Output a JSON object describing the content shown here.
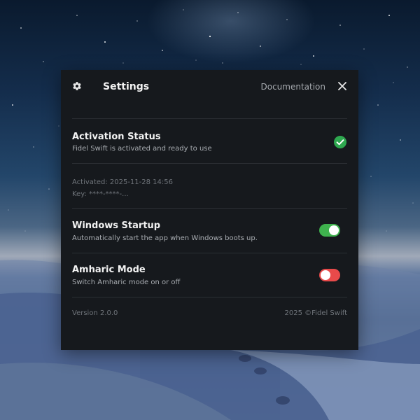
{
  "window": {
    "title": "Settings",
    "documentation_label": "Documentation",
    "icons": {
      "title": "gear-icon",
      "close": "close-icon"
    }
  },
  "activation": {
    "title": "Activation Status",
    "description": "Fidel Swift is activated and ready to use",
    "activated_at": "Activated: 2025-11-28 14:56",
    "key": "Key: ****-****-...",
    "status_icon": "check-circle-icon",
    "status_color": "#2ea84f"
  },
  "startup": {
    "title": "Windows Startup",
    "description": "Automatically start the app when Windows boots up.",
    "enabled": true,
    "color": "#3fb24e"
  },
  "amharic": {
    "title": "Amharic Mode",
    "description": "Switch Amharic mode on or off",
    "enabled": false,
    "color": "#e84a4a"
  },
  "footer": {
    "version": "Version 2.0.0",
    "copyright": "2025 ©Fidel Swift"
  }
}
